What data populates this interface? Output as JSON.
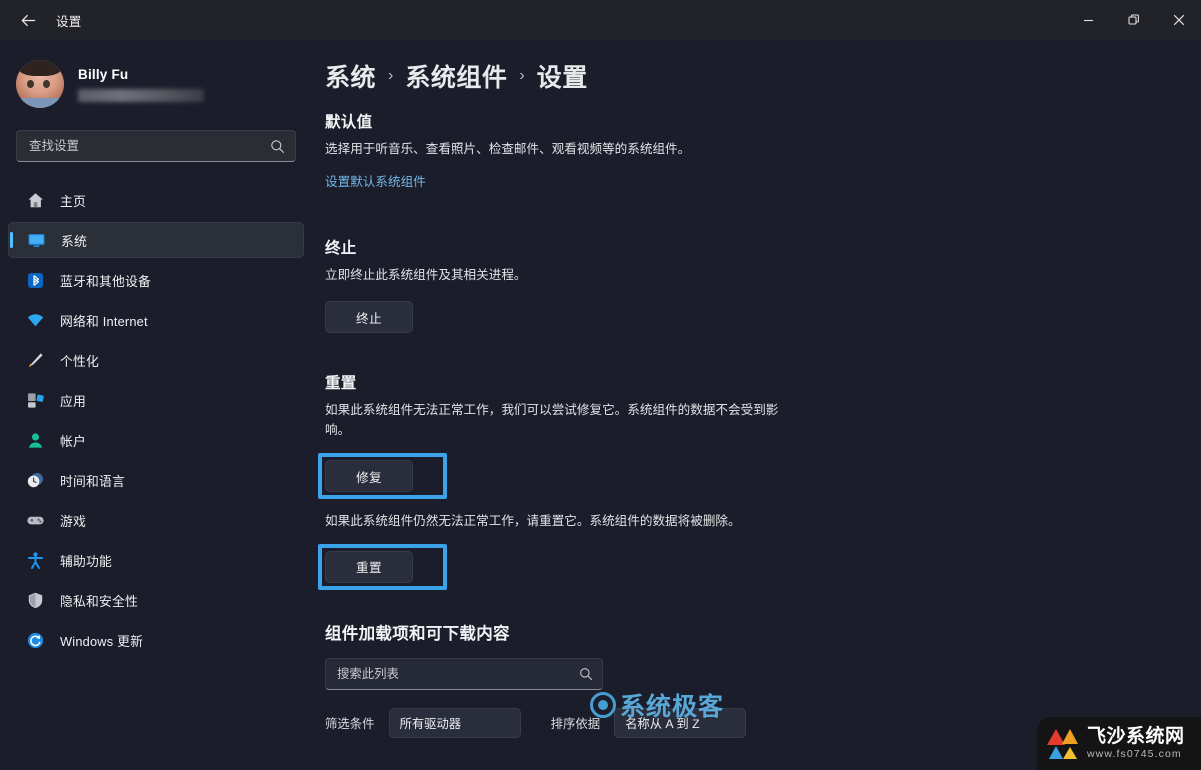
{
  "titlebar": {
    "title": "设置",
    "back_icon": "back-arrow-icon",
    "minimize": "—",
    "maximize": "❐",
    "close": "✕"
  },
  "sidebar": {
    "account": {
      "name": "Billy Fu",
      "email_redacted": ""
    },
    "search": {
      "placeholder": "查找设置",
      "value": "",
      "icon": "search-icon"
    },
    "items": [
      {
        "label": "主页",
        "icon": "home-icon",
        "active": false
      },
      {
        "label": "系统",
        "icon": "display-icon",
        "active": true
      },
      {
        "label": "蓝牙和其他设备",
        "icon": "bluetooth-icon",
        "active": false
      },
      {
        "label": "网络和 Internet",
        "icon": "wifi-icon",
        "active": false
      },
      {
        "label": "个性化",
        "icon": "brush-icon",
        "active": false
      },
      {
        "label": "应用",
        "icon": "apps-icon",
        "active": false
      },
      {
        "label": "帐户",
        "icon": "account-icon",
        "active": false
      },
      {
        "label": "时间和语言",
        "icon": "clock-icon",
        "active": false
      },
      {
        "label": "游戏",
        "icon": "gamepad-icon",
        "active": false
      },
      {
        "label": "辅助功能",
        "icon": "accessibility-icon",
        "active": false
      },
      {
        "label": "隐私和安全性",
        "icon": "shield-icon",
        "active": false
      },
      {
        "label": "Windows 更新",
        "icon": "update-icon",
        "active": false
      }
    ]
  },
  "main": {
    "breadcrumb": {
      "crumb1": "系统",
      "crumb2": "系统组件",
      "crumb3": "设置",
      "separator": "›"
    },
    "defaults": {
      "title": "默认值",
      "description": "选择用于听音乐、查看照片、检查邮件、观看视频等的系统组件。",
      "link": "设置默认系统组件"
    },
    "terminate": {
      "title": "终止",
      "description": "立即终止此系统组件及其相关进程。",
      "button": "终止"
    },
    "reset": {
      "title": "重置",
      "repair_description": "如果此系统组件无法正常工作，我们可以尝试修复它。系统组件的数据不会受到影响。",
      "repair_button": "修复",
      "reset_description": "如果此系统组件仍然无法正常工作，请重置它。系统组件的数据将被删除。",
      "reset_button": "重置"
    },
    "addons": {
      "title": "组件加载项和可下载内容",
      "search_placeholder": "搜索此列表",
      "search_value": "",
      "search_icon": "search-icon",
      "filter_label": "筛选条件",
      "filter_value": "所有驱动器",
      "sort_label": "排序依据",
      "sort_value": "名称从 A 到 Z"
    }
  },
  "watermarks": {
    "center": "系统极客",
    "corner_name": "飞沙系统网",
    "corner_url": "www.fs0745.com"
  },
  "colors": {
    "accent": "#4cc2ff",
    "annotation": "#3ba3ea",
    "link": "#72b7e8",
    "background": "#1b1e2a",
    "titlebar": "#212329",
    "selected": "#2b2f38"
  }
}
